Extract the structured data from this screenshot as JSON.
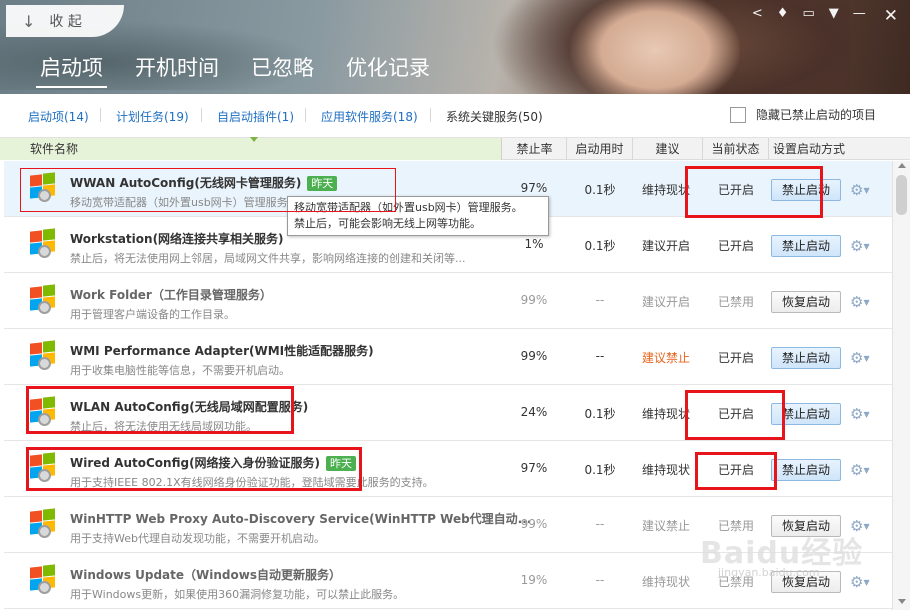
{
  "header": {
    "collapse_label": "收 起",
    "tabs": [
      {
        "label": "启动项",
        "active": true
      },
      {
        "label": "开机时间",
        "active": false
      },
      {
        "label": "已忽略",
        "active": false
      },
      {
        "label": "优化记录",
        "active": false
      }
    ]
  },
  "subtabs": {
    "items": [
      "启动项(14)",
      "计划任务(19)",
      "自启动插件(1)",
      "应用软件服务(18)",
      "系统关键服务(50)"
    ],
    "hide_disabled_label": "隐藏已禁止启动的项目"
  },
  "columns": {
    "name": "软件名称",
    "rate": "禁止率",
    "time": "启动用时",
    "suggest": "建议",
    "state": "当前状态",
    "method": "设置启动方式"
  },
  "rows": [
    {
      "title": "WWAN AutoConfig(无线网卡管理服务)",
      "badge": "昨天",
      "desc": "移动宽带适配器（如外置usb网卡）管理服务。禁止后，可能会影响无线上网等",
      "rate": "97%",
      "time": "0.1秒",
      "suggest": "维持现状",
      "state": "已开启",
      "action": "禁止启动"
    },
    {
      "title": "Workstation(网络连接共享相关服务)",
      "badge": "",
      "desc": "禁止后，将无法使用网上邻居，局域网文件共享，影响网络连接的创建和关闭等...",
      "rate": "1%",
      "time": "0.1秒",
      "suggest": "建议开启",
      "state": "已开启",
      "action": "禁止启动"
    },
    {
      "title": "Work Folder（工作目录管理服务）",
      "badge": "",
      "desc": "用于管理客户端设备的工作目录。",
      "rate": "99%",
      "time": "--",
      "suggest": "建议开启",
      "state": "已禁用",
      "action": "恢复启动"
    },
    {
      "title": "WMI Performance Adapter(WMI性能适配器服务)",
      "badge": "",
      "desc": "用于收集电脑性能等信息，不需要开机启动。",
      "rate": "99%",
      "time": "--",
      "suggest": "建议禁止",
      "state": "已开启",
      "action": "禁止启动"
    },
    {
      "title": "WLAN AutoConfig(无线局域网配置服务)",
      "badge": "",
      "desc": "禁止后，将无法使用无线局域网功能。",
      "rate": "24%",
      "time": "0.1秒",
      "suggest": "维持现状",
      "state": "已开启",
      "action": "禁止启动"
    },
    {
      "title": "Wired AutoConfig(网络接入身份验证服务)",
      "badge": "昨天",
      "desc": "用于支持IEEE 802.1X有线网络身份验证功能，登陆域需要此服务的支持。",
      "rate": "97%",
      "time": "0.1秒",
      "suggest": "维持现状",
      "state": "已开启",
      "action": "禁止启动"
    },
    {
      "title": "WinHTTP Web Proxy Auto-Discovery Service(WinHTTP Web代理自动...",
      "badge": "",
      "desc": "用于支持Web代理自动发现功能，不需要开机启动。",
      "rate": "99%",
      "time": "--",
      "suggest": "建议禁止",
      "state": "已禁用",
      "action": "恢复启动"
    },
    {
      "title": "Windows Update（Windows自动更新服务）",
      "badge": "",
      "desc": "用于Windows更新，如果使用360漏洞修复功能，可以禁止此服务。",
      "rate": "19%",
      "time": "--",
      "suggest": "维持现状",
      "state": "已禁用",
      "action": "恢复启动"
    }
  ],
  "tooltip": {
    "line1": "移动宽带适配器（如外置usb网卡）管理服务。",
    "line2": "禁止后，可能会影响无线上网等功能。"
  },
  "watermark": {
    "text": "Baidu经验",
    "sub": "jingyan.baidu.com"
  },
  "colors": {
    "accent": "#1f6fc2",
    "badge": "#4caf50",
    "highlight": "#e8141c",
    "warn": "#e8641c"
  }
}
